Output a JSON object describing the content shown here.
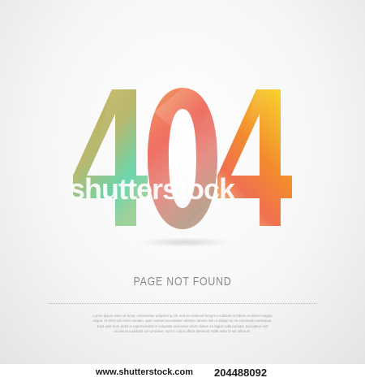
{
  "error": {
    "code_digits": [
      "4",
      "0",
      "4"
    ],
    "headline": "PAGE NOT FOUND",
    "filler_text": "Lorem ipsum dolor sit amet, consectetur adipisicing elit, sed do eiusmod tempor incididunt ut labore et dolore magna aliqua. Ut enim ad minim veniam, quis nostrud exercitation ullamco laboris nisi ut aliquip ex ea commodo consequat. Duis aute irure dolor in reprehenderit in voluptate velit esse cillum dolore eu fugiat nulla pariatur. Excepteur sint occaecat cupidatat non proident, sunt in culpa officia deserunt mollit anim id est laborum."
  },
  "watermark": {
    "text": "shutterstock"
  },
  "footer": {
    "site": "www.shutterstock.com",
    "image_id": "204488092"
  },
  "colors": {
    "digit_left": [
      "#c8b25a",
      "#a9c27a",
      "#5fd8b0"
    ],
    "digit_middle": [
      "#f08a5a",
      "#f0707a",
      "#c9a2a0"
    ],
    "digit_right": [
      "#f4c030",
      "#f08a30",
      "#e6c07a"
    ]
  }
}
